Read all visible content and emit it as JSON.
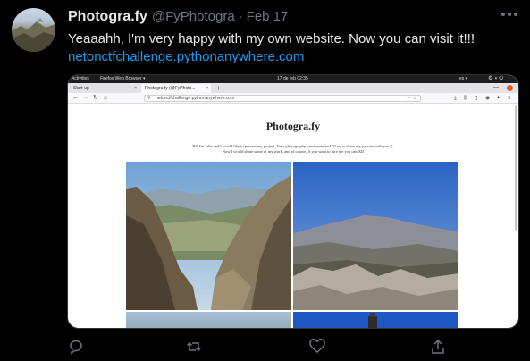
{
  "tweet": {
    "display_name": "Photogra.fy",
    "handle": "@FyPhotogra",
    "separator": "·",
    "date": "Feb 17",
    "text": "Yeaaahh, I'm very happy with my own website. Now you can visit it!!!",
    "link": "netonctfchallenge.pythonanywhere.com"
  },
  "screenshot": {
    "os_bar": {
      "activities": "Activities",
      "app": "Firefox Web Browser ▾",
      "clock": "17 de feb  02:35",
      "locale": "es ▾"
    },
    "tabs": [
      {
        "label": "Start-up"
      },
      {
        "label": "Photogra.fy (@FyPhoto..."
      }
    ],
    "new_tab": "+",
    "url": "netonctfchallenge.pythonanywhere.com",
    "site": {
      "title": "Photogra.fy",
      "intro_line1": "Hi! I'm Jake and I would like to present my project. I'm a photography passionate and I'll try to share my passion with you ;).",
      "intro_line2": "Now I would share some of my work, and of course, if you want to hire me you can XD"
    }
  },
  "icons": [
    "more-icon",
    "reply-icon",
    "retweet-icon",
    "like-icon",
    "share-icon"
  ],
  "colors": {
    "link": "#1d9bf0",
    "muted": "#6e767d",
    "background": "#000000"
  }
}
